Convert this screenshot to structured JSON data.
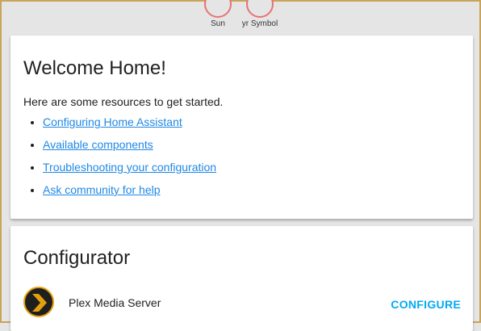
{
  "badges": [
    {
      "label": "Sun"
    },
    {
      "label": "yr Symbol"
    }
  ],
  "welcome": {
    "title": "Welcome Home!",
    "intro": "Here are some resources to get started.",
    "links": [
      "Configuring Home Assistant",
      "Available components",
      "Troubleshooting your configuration",
      "Ask community for help"
    ]
  },
  "configurator": {
    "title": "Configurator",
    "item_name": "Plex Media Server",
    "action_label": "CONFIGURE"
  },
  "colors": {
    "link": "#1e88e5",
    "action": "#03a9f4",
    "badge_ring": "#e57373",
    "plex_accent": "#e5a00d"
  }
}
